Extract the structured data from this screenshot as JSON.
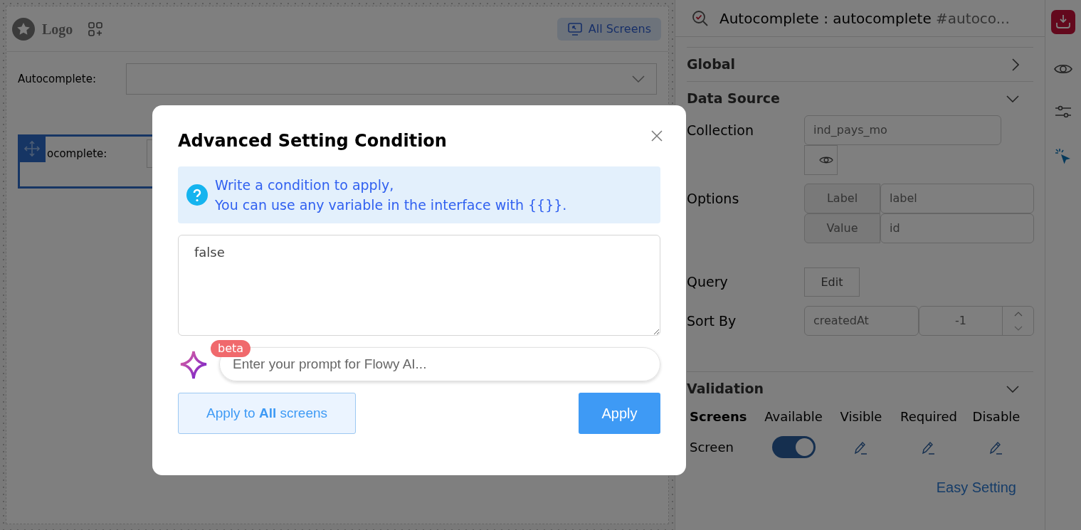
{
  "canvas": {
    "logo": "Logo",
    "all_screens": "All Screens",
    "fields": [
      {
        "label": "Autocomplete:",
        "selected": false
      },
      {
        "label": "ocomplete:",
        "selected": true
      }
    ]
  },
  "inspector": {
    "title": "Autocomplete : autocomplete",
    "title_id": "#autoco...",
    "sections": [
      {
        "title": "Global",
        "expanded": false
      },
      {
        "title": "Data Source",
        "expanded": true
      },
      {
        "title": "Validation",
        "expanded": true
      }
    ],
    "collection": {
      "label": "Collection",
      "value": "ind_pays_mo"
    },
    "options": {
      "label": "Options",
      "rows": [
        {
          "key": "Label",
          "value": "label"
        },
        {
          "key": "Value",
          "value": "id"
        }
      ]
    },
    "query": {
      "label": "Query",
      "button": "Edit"
    },
    "sort": {
      "label": "Sort By",
      "field": "createdAt",
      "order": "-1"
    },
    "validation": {
      "columns": [
        "Screens",
        "Available",
        "Visible",
        "Required",
        "Disable"
      ],
      "rows": [
        {
          "name": "Screen",
          "available": true
        }
      ],
      "link": "Easy Setting"
    }
  },
  "modal": {
    "title": "Advanced Setting Condition",
    "info": [
      "Write a condition to apply,",
      "You can use any variable in the interface with {{}}."
    ],
    "condition": "false",
    "badge": "beta",
    "ai_placeholder": "Enter your prompt for Flowy AI...",
    "apply_all": "Apply to **All** screens",
    "apply": "Apply"
  }
}
